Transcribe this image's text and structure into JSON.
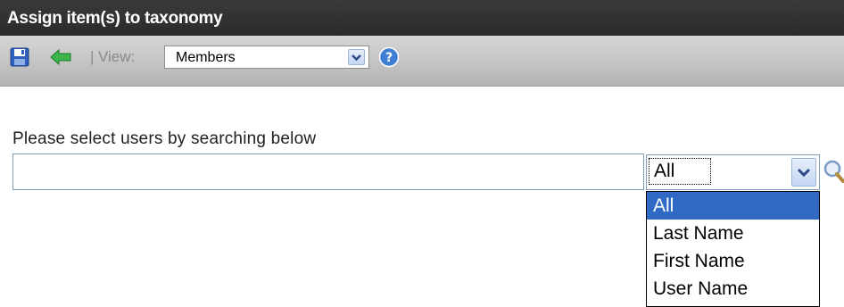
{
  "title_bar": {
    "title": "Assign item(s) to taxonomy"
  },
  "toolbar": {
    "save_icon": "save-disk-icon",
    "back_icon": "back-arrow-icon",
    "separator": "|",
    "view_label": "View:",
    "view_select": {
      "selected": "Members"
    },
    "help_icon": "help-question-icon"
  },
  "main": {
    "instructions": "Please select users by searching below",
    "search_input": {
      "value": "",
      "placeholder": ""
    },
    "filter_select": {
      "selected": "All",
      "options": [
        "All",
        "Last Name",
        "First Name",
        "User Name"
      ],
      "highlighted_index": 0
    },
    "search_icon": "magnifier-icon"
  },
  "colors": {
    "title_bar_bg": "#2f2f2f",
    "toolbar_bg": "#c4c4c4",
    "selection_highlight": "#316ac5",
    "input_border": "#7f9db9",
    "back_arrow": "#39b54a",
    "help_icon": "#3d7fd4"
  }
}
